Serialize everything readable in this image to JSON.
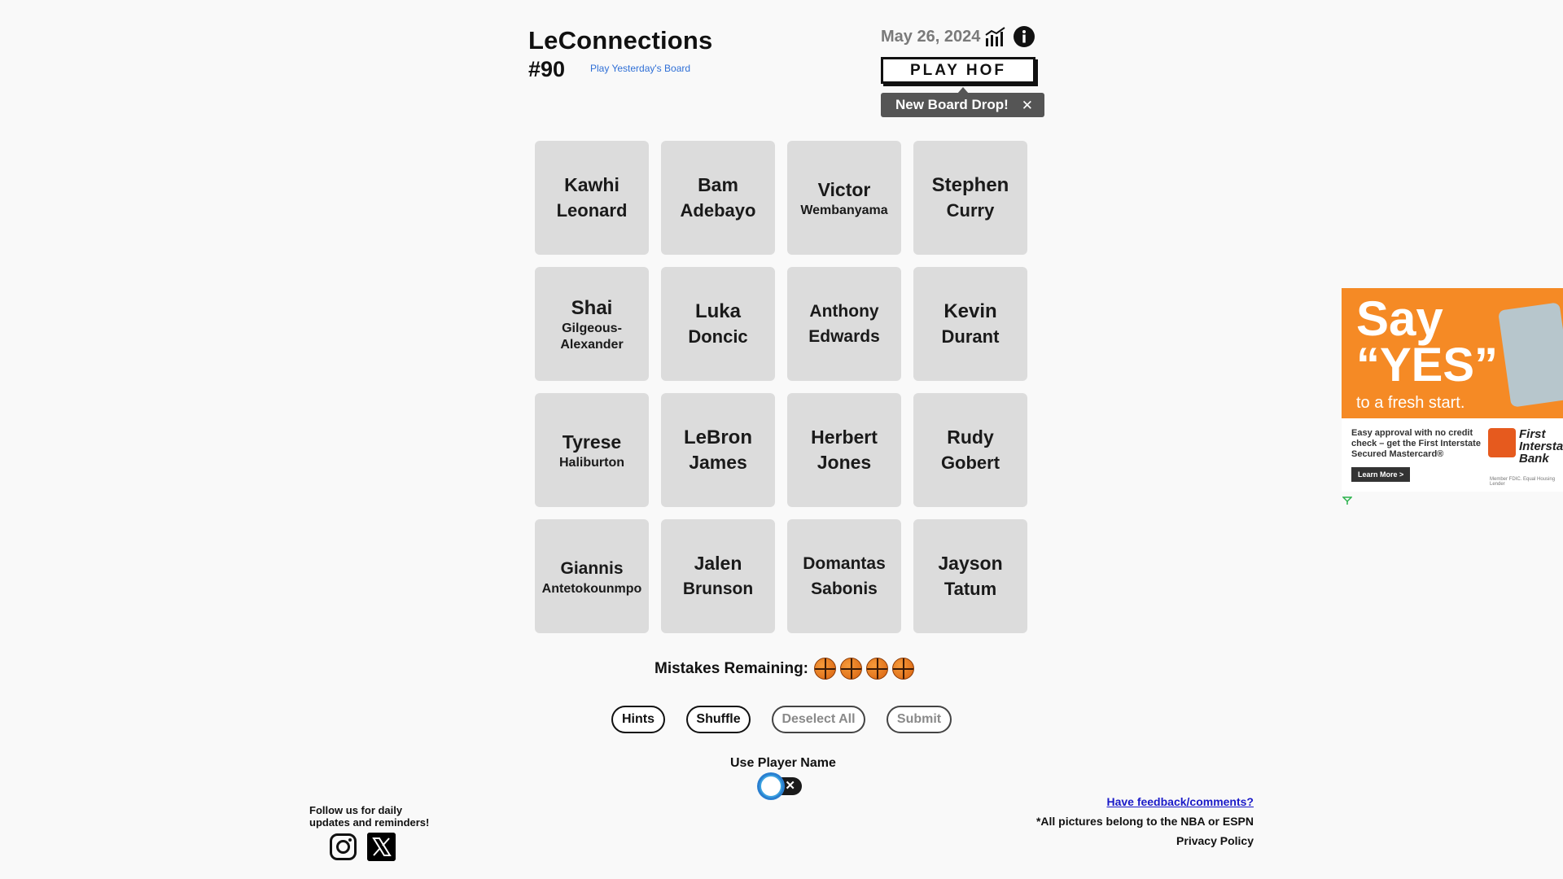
{
  "header": {
    "title": "LeConnections",
    "puzzle_number": "#90",
    "yesterday_link": "Play Yesterday's Board",
    "date": "May 26, 2024",
    "stats_icon": "bar-chart-icon",
    "info_icon": "info-icon",
    "play_hof": "PLAY HOF",
    "toast": "New Board Drop!",
    "toast_close": "✕"
  },
  "tiles": [
    {
      "first": "Kawhi",
      "last": "Leonard"
    },
    {
      "first": "Bam",
      "last": "Adebayo"
    },
    {
      "first": "Victor",
      "last": "Wembanyama"
    },
    {
      "first": "Stephen",
      "last": "Curry"
    },
    {
      "first": "Shai",
      "last": "Gilgeous-Alexander"
    },
    {
      "first": "Luka",
      "last": "Doncic"
    },
    {
      "first": "Anthony",
      "last": "Edwards"
    },
    {
      "first": "Kevin",
      "last": "Durant"
    },
    {
      "first": "Tyrese",
      "last": "Haliburton"
    },
    {
      "first": "LeBron",
      "last": "James"
    },
    {
      "first": "Herbert",
      "last": "Jones"
    },
    {
      "first": "Rudy",
      "last": "Gobert"
    },
    {
      "first": "Giannis",
      "last": "Antetokounmpo"
    },
    {
      "first": "Jalen",
      "last": "Brunson"
    },
    {
      "first": "Domantas",
      "last": "Sabonis"
    },
    {
      "first": "Jayson",
      "last": "Tatum"
    }
  ],
  "mistakes": {
    "label": "Mistakes Remaining:",
    "remaining": 4,
    "icon": "basketball-icon"
  },
  "buttons": {
    "hints": "Hints",
    "shuffle": "Shuffle",
    "deselect_all": "Deselect All",
    "submit": "Submit"
  },
  "toggle": {
    "label": "Use Player Name",
    "state": "off",
    "off_mark": "✕"
  },
  "footer": {
    "follow": "Follow us for daily updates and reminders!",
    "instagram_icon": "instagram-icon",
    "x_icon": "x-logo-icon",
    "feedback": "Have feedback/comments?",
    "credits": "*All pictures belong to the NBA or ESPN",
    "privacy": "Privacy Policy"
  },
  "ad": {
    "say": "Say",
    "yes": "“YES”",
    "fresh": "to a fresh start.",
    "body": "Easy approval with no credit check – get the First Interstate Secured Mastercard®",
    "learn_more": "Learn More >",
    "brand": "First Interstate Bank",
    "fine_print": "Member FDIC. Equal Housing Lender",
    "brand_color": "#f58a25"
  }
}
